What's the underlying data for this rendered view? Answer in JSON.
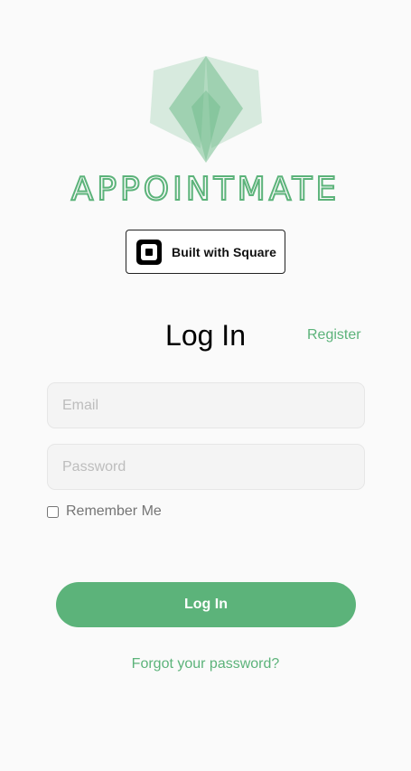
{
  "brand": {
    "name": "APPOINTMATE",
    "logo_icon": "lotus-logo-icon",
    "accent_color": "#5cb37a"
  },
  "square_badge": {
    "label": "Built with Square",
    "icon": "square-logo-icon"
  },
  "login": {
    "title": "Log In",
    "register_label": "Register",
    "email": {
      "value": "",
      "placeholder": "Email"
    },
    "password": {
      "value": "",
      "placeholder": "Password"
    },
    "remember_label": "Remember Me",
    "remember_checked": false,
    "submit_label": "Log In",
    "forgot_label": "Forgot your password?"
  }
}
